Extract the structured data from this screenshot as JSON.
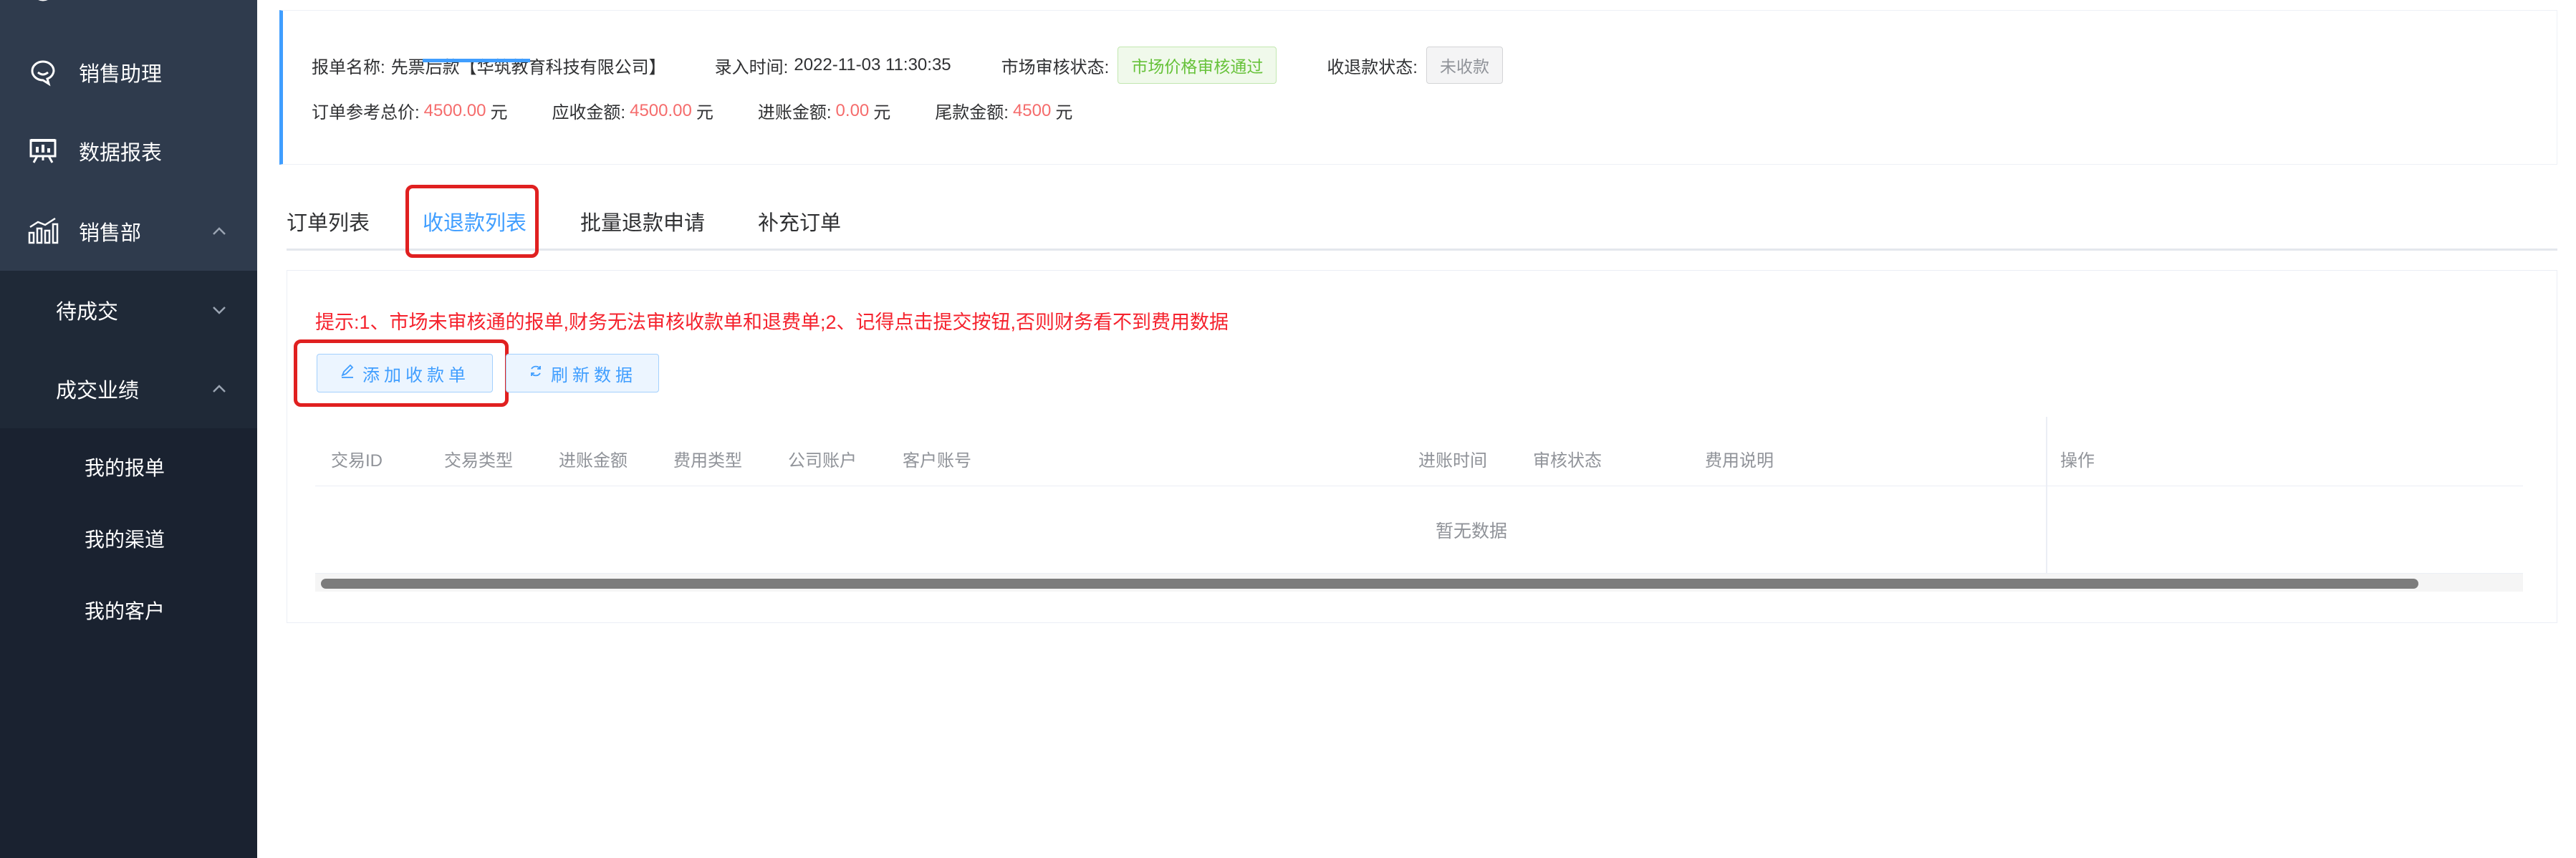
{
  "sidebar": {
    "items": [
      {
        "label": "销售助理",
        "icon": "chat-bubble-icon"
      },
      {
        "label": "数据报表",
        "icon": "presentation-chart-icon"
      },
      {
        "label": "销售部",
        "icon": "bar-chart-icon"
      }
    ],
    "submenus": [
      {
        "label": "待成交"
      },
      {
        "label": "成交业绩"
      }
    ],
    "leaves": [
      {
        "label": "我的报单"
      },
      {
        "label": "我的渠道"
      },
      {
        "label": "我的客户"
      }
    ]
  },
  "info": {
    "name_label": "报单名称:",
    "name_value": "先票后款【华筑教育科技有限公司】",
    "time_label": "录入时间:",
    "time_value": "2022-11-03 11:30:35",
    "market_label": "市场审核状态:",
    "market_status": "市场价格审核通过",
    "refund_label": "收退款状态:",
    "refund_status": "未收款",
    "ref_total_label": "订单参考总价:",
    "ref_total_value": "4500.00",
    "receivable_label": "应收金额:",
    "receivable_value": "4500.00",
    "income_label": "进账金额:",
    "income_value": "0.00",
    "balance_label": "尾款金额:",
    "balance_value": "4500",
    "unit": "元"
  },
  "tabs": [
    {
      "label": "订单列表",
      "active": false
    },
    {
      "label": "收退款列表",
      "active": true
    },
    {
      "label": "批量退款申请",
      "active": false
    },
    {
      "label": "补充订单",
      "active": false
    }
  ],
  "panel": {
    "tip": "提示:1、市场未审核通的报单,财务无法审核收款单和退费单;2、记得点击提交按钮,否则财务看不到费用数据",
    "add_button": "添加收款单",
    "refresh_button": "刷新数据"
  },
  "table": {
    "columns": [
      "交易ID",
      "交易类型",
      "进账金额",
      "费用类型",
      "公司账户",
      "客户账号",
      "进账时间",
      "审核状态",
      "费用说明",
      "操作"
    ],
    "empty_text": "暂无数据"
  },
  "colors": {
    "sidebar_bg": "#2f3b4d",
    "accent": "#409eff",
    "highlight": "#e02020",
    "money": "#f56c6c",
    "tip": "#f5222d"
  }
}
